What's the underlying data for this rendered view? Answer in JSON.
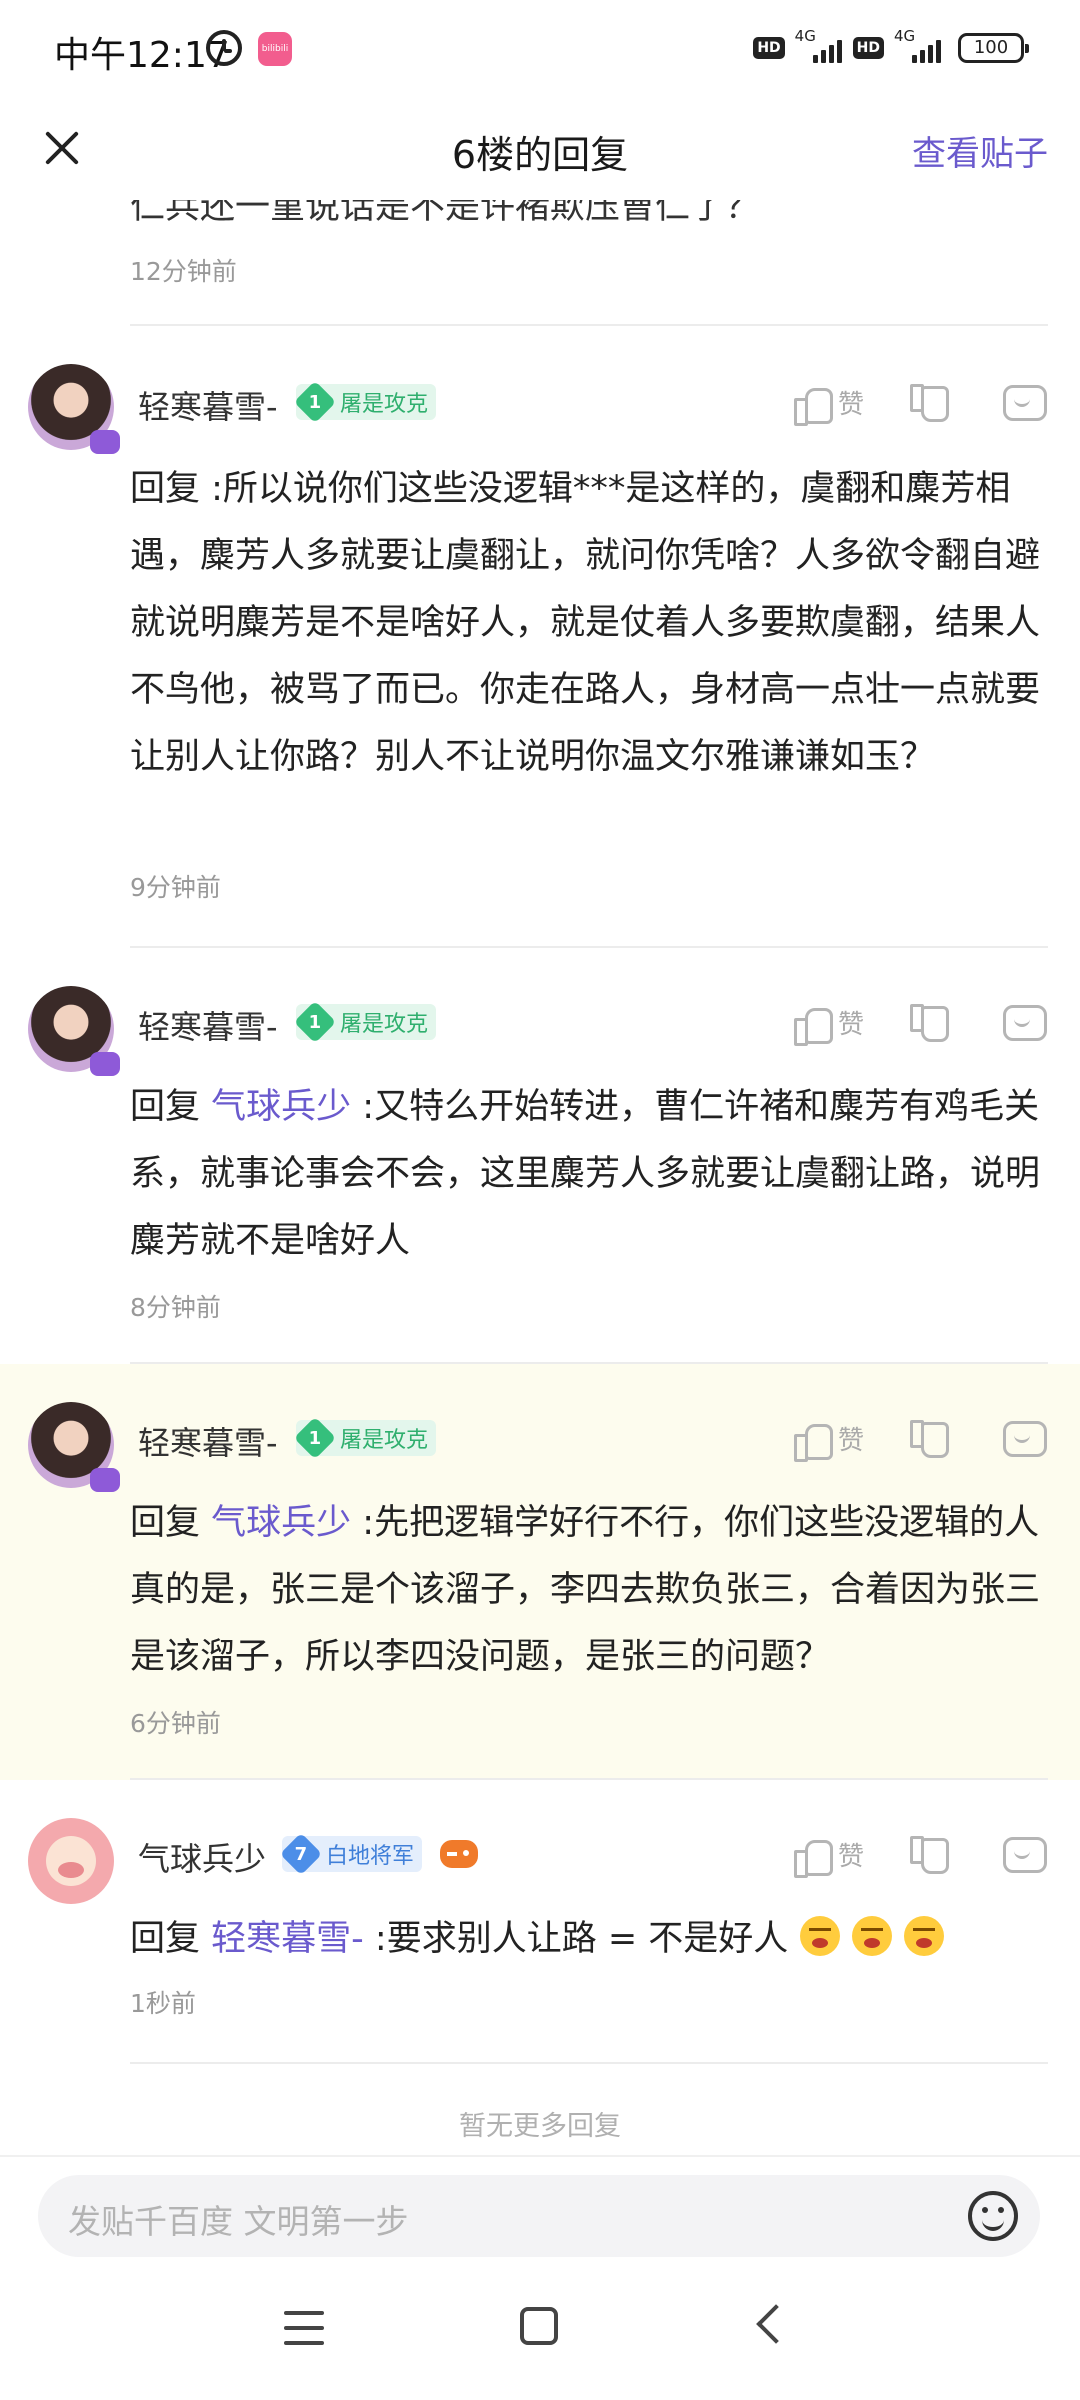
{
  "status_bar": {
    "time": "中午12:17",
    "app_icon_text": "bilibili",
    "hd1": "HD",
    "net1": "4G",
    "hd2": "HD",
    "net2": "4G",
    "battery": "100"
  },
  "header": {
    "title": "6楼的回复",
    "view_post": "查看贴子"
  },
  "partial": {
    "text": "仁兵还一堇说话是不是许褚欺压曹仁了？",
    "time": "12分钟前"
  },
  "replies": [
    {
      "username": "轻寒暮雪-",
      "level": "1",
      "badge": "屠是攻克",
      "like_label": "赞",
      "prefix": "回复",
      "mention": "",
      "text": " :所以说你们这些没逻辑***是这样的，虞翻和麋芳相遇，麋芳人多就要让虞翻让，就问你凭啥？人多欲令翻自避就说明麋芳是不是啥好人，就是仗着人多要欺虞翻，结果人不鸟他，被骂了而已。你走在路人，身材高一点壮一点就要让别人让你路？别人不让说明你温文尔雅谦谦如玉？",
      "time": "9分钟前"
    },
    {
      "username": "轻寒暮雪-",
      "level": "1",
      "badge": "屠是攻克",
      "like_label": "赞",
      "prefix": "回复",
      "mention": "气球兵少",
      "text": " :又特么开始转进，曹仁许褚和麋芳有鸡毛关系，就事论事会不会，这里麋芳人多就要让虞翻让路，说明麋芳就不是啥好人",
      "time": "8分钟前"
    },
    {
      "username": "轻寒暮雪-",
      "level": "1",
      "badge": "屠是攻克",
      "like_label": "赞",
      "prefix": "回复",
      "mention": "气球兵少",
      "text": " :先把逻辑学好行不行，你们这些没逻辑的人真的是，张三是个该溜子，李四去欺负张三，合着因为张三是该溜子，所以李四没问题，是张三的问题？",
      "time": "6分钟前"
    },
    {
      "username": "气球兵少",
      "level": "7",
      "badge": "白地将军",
      "like_label": "赞",
      "prefix": "回复",
      "mention": "轻寒暮雪-",
      "text": " :要求别人让路 = 不是好人",
      "time": "1秒前"
    }
  ],
  "footer": {
    "no_more": "暂无更多回复",
    "input_placeholder": "发贴千百度 文明第一步"
  },
  "colors": {
    "accent": "#6a5acd",
    "highlight_bg": "#fdfcee",
    "badge_green": "#35bf7c",
    "badge_blue": "#4c8ee8"
  }
}
